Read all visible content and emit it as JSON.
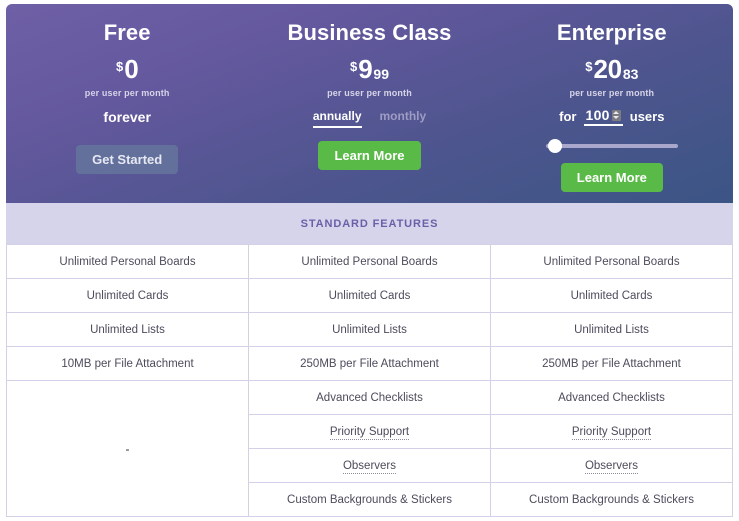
{
  "plans": [
    {
      "name": "Free",
      "currency": "$",
      "amount": "0",
      "cents": "",
      "per_unit": "per user per month",
      "term_label": "forever",
      "cta": "Get Started",
      "cta_style": "muted"
    },
    {
      "name": "Business Class",
      "currency": "$",
      "amount": "9",
      "cents": "99",
      "per_unit": "per user per month",
      "billing_options": [
        {
          "label": "annually",
          "active": true
        },
        {
          "label": "monthly",
          "active": false
        }
      ],
      "cta": "Learn More",
      "cta_style": "green"
    },
    {
      "name": "Enterprise",
      "currency": "$",
      "amount": "20",
      "cents": "83",
      "per_unit": "per user per month",
      "users_prefix": "for",
      "users_value": "100",
      "users_suffix": "users",
      "slider": {
        "value": 100,
        "min": 100,
        "max": 5000,
        "fill_percent": 2
      },
      "cta": "Learn More",
      "cta_style": "green"
    }
  ],
  "features_band": {
    "title": "STANDARD FEATURES"
  },
  "features_table": {
    "rows": [
      {
        "free": "Unlimited Personal Boards",
        "business": "Unlimited Personal Boards",
        "enterprise": "Unlimited Personal Boards"
      },
      {
        "free": "Unlimited Cards",
        "business": "Unlimited Cards",
        "enterprise": "Unlimited Cards"
      },
      {
        "free": "Unlimited Lists",
        "business": "Unlimited Lists",
        "enterprise": "Unlimited Lists"
      },
      {
        "free": "10MB per File Attachment",
        "business": "250MB per File Attachment",
        "enterprise": "250MB per File Attachment"
      }
    ],
    "free_merged_cell": "-",
    "extra_rows": [
      {
        "business": "Advanced Checklists",
        "enterprise": "Advanced Checklists",
        "hint": false
      },
      {
        "business": "Priority Support",
        "enterprise": "Priority Support",
        "hint": true
      },
      {
        "business": "Observers",
        "enterprise": "Observers",
        "hint": true
      },
      {
        "business": "Custom Backgrounds & Stickers",
        "enterprise": "Custom Backgrounds & Stickers",
        "hint": false
      }
    ]
  },
  "colors": {
    "header_gradient_start": "#6f60a6",
    "header_gradient_end": "#3b5585",
    "accent_green": "#5aba47",
    "band_background": "#d6d4ea",
    "band_text": "#6a5fa8",
    "table_border": "#d3d1e8"
  }
}
